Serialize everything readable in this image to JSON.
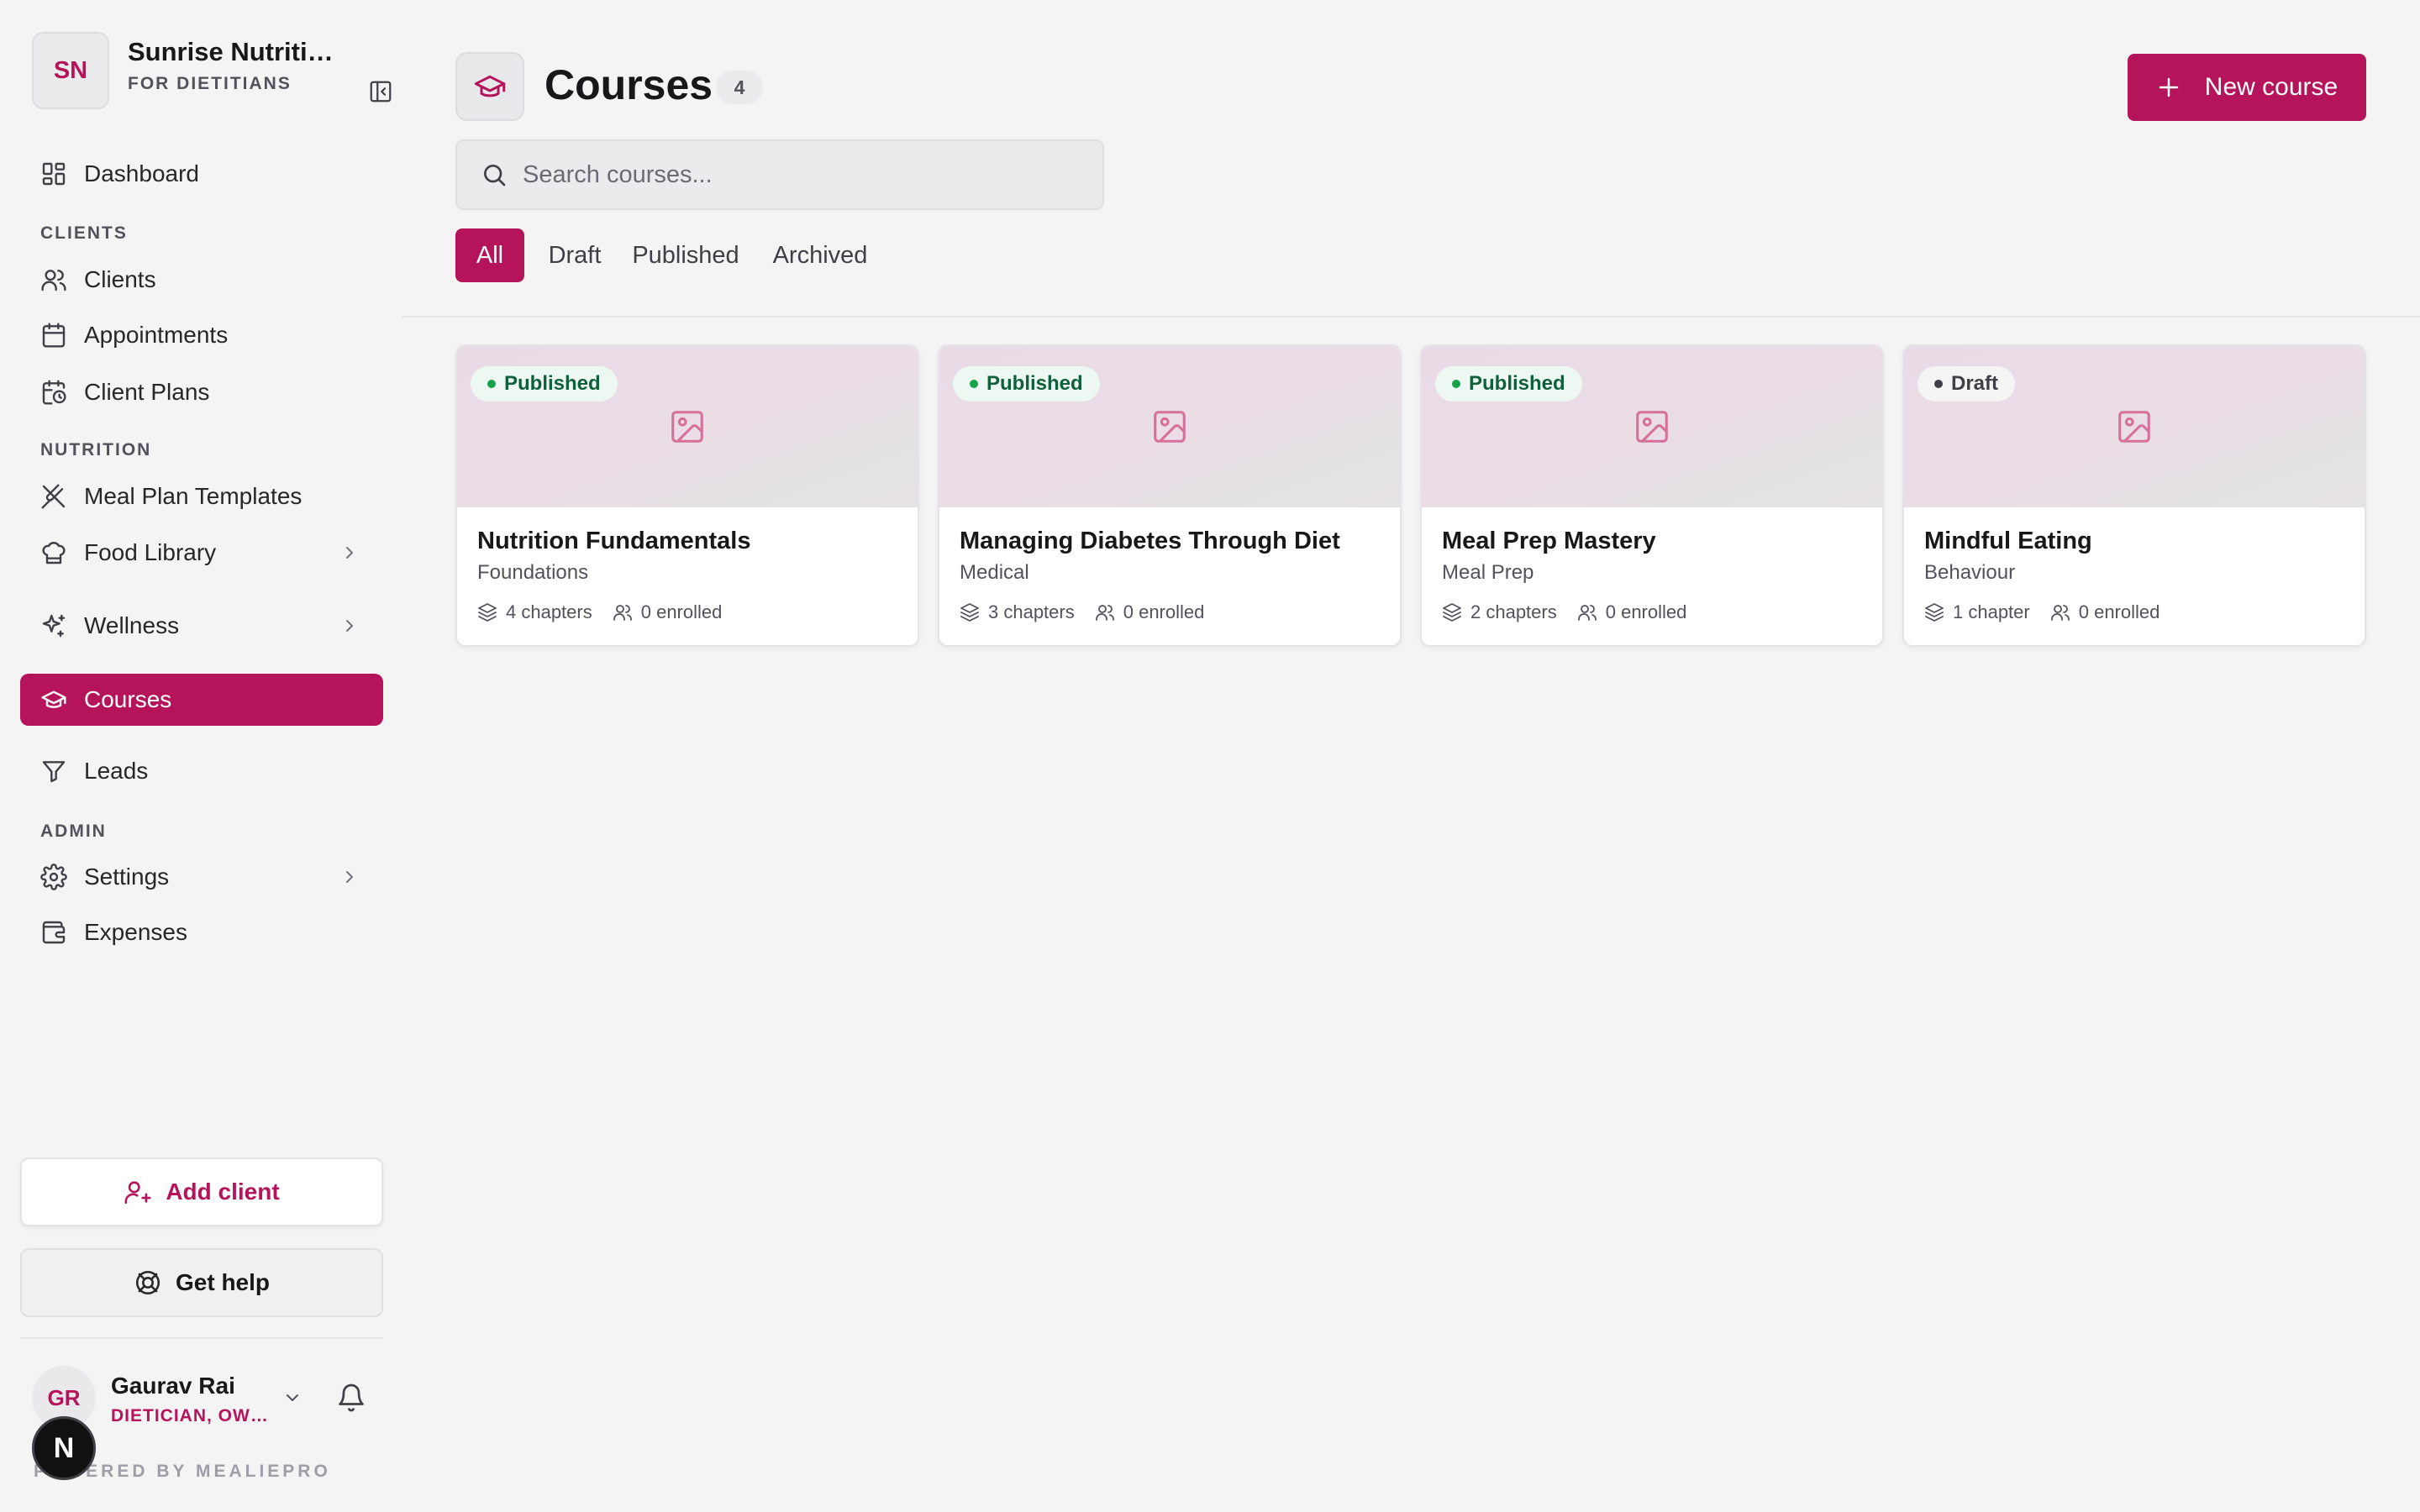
{
  "org": {
    "initials": "SN",
    "name": "Sunrise Nutrition",
    "subtitle": "FOR DIETITIANS"
  },
  "nav": {
    "dashboard": "Dashboard",
    "section_clients": "CLIENTS",
    "clients": "Clients",
    "appointments": "Appointments",
    "client_plans": "Client Plans",
    "section_nutrition": "NUTRITION",
    "meal_plan_templates": "Meal Plan Templates",
    "food_library": "Food Library",
    "wellness": "Wellness",
    "courses": "Courses",
    "leads": "Leads",
    "section_admin": "ADMIN",
    "settings": "Settings",
    "expenses": "Expenses"
  },
  "sidebar_actions": {
    "add_client": "Add client",
    "get_help": "Get help"
  },
  "user": {
    "initials": "GR",
    "name": "Gaurav Rai",
    "role": "DIETICIAN, OWNER"
  },
  "next_badge": "N",
  "powered_by": "POWERED BY MEALIEPRO",
  "page": {
    "title": "Courses",
    "count": "4",
    "new_button": "New course"
  },
  "search": {
    "placeholder": "Search courses...",
    "value": ""
  },
  "tabs": [
    "All",
    "Draft",
    "Published",
    "Archived"
  ],
  "active_tab": "All",
  "colors": {
    "accent": "#b5135a",
    "published": "#16a34a"
  },
  "courses": [
    {
      "status": "Published",
      "title": "Nutrition Fundamentals",
      "category": "Foundations",
      "chapters": "4 chapters",
      "enrolled": "0 enrolled"
    },
    {
      "status": "Published",
      "title": "Managing Diabetes Through Diet",
      "category": "Medical",
      "chapters": "3 chapters",
      "enrolled": "0 enrolled"
    },
    {
      "status": "Published",
      "title": "Meal Prep Mastery",
      "category": "Meal Prep",
      "chapters": "2 chapters",
      "enrolled": "0 enrolled"
    },
    {
      "status": "Draft",
      "title": "Mindful Eating",
      "category": "Behaviour",
      "chapters": "1 chapter",
      "enrolled": "0 enrolled"
    }
  ]
}
